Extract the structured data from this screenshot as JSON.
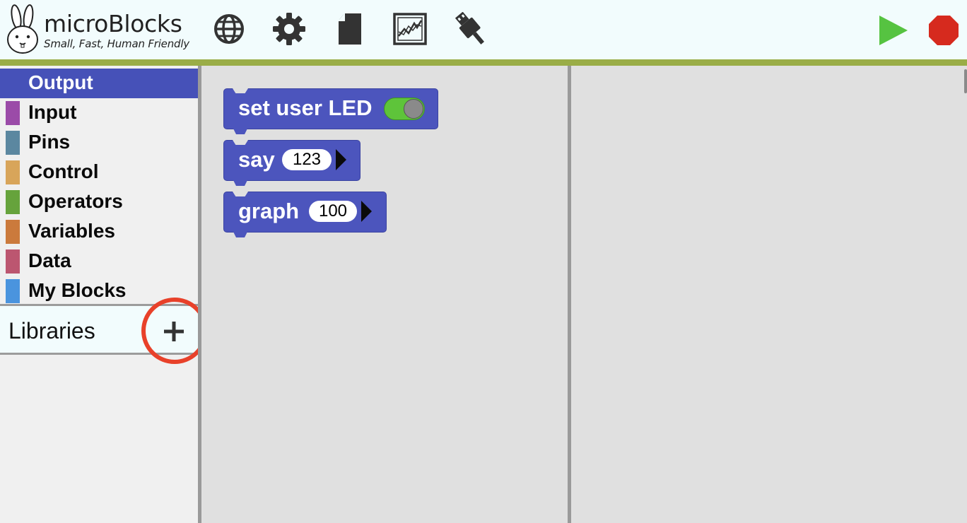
{
  "header": {
    "app_name": "microBlocks",
    "tagline": "Small, Fast, Human Friendly",
    "icons": [
      "bunny-logo-icon",
      "globe-icon",
      "gear-icon",
      "file-icon",
      "graph-icon",
      "usb-plug-icon",
      "play-icon",
      "stop-icon"
    ],
    "colors": {
      "go": "#56c341",
      "stop": "#d62a1e",
      "accent": "#9aad47"
    }
  },
  "palette": {
    "categories": [
      {
        "label": "Output",
        "color": "#4651b8",
        "selected": true
      },
      {
        "label": "Input",
        "color": "#9b4ba8"
      },
      {
        "label": "Pins",
        "color": "#5b87a0"
      },
      {
        "label": "Control",
        "color": "#d8a55a"
      },
      {
        "label": "Operators",
        "color": "#66a33c"
      },
      {
        "label": "Variables",
        "color": "#cb7a3c"
      },
      {
        "label": "Data",
        "color": "#bc5670"
      },
      {
        "label": "My Blocks",
        "color": "#4a94de"
      }
    ],
    "libraries_label": "Libraries",
    "add_library_icon": "plus-icon"
  },
  "blocks": {
    "set_user_led": {
      "label": "set user LED",
      "toggle_on": true
    },
    "say": {
      "label": "say",
      "value": "123"
    },
    "graph": {
      "label": "graph",
      "value": "100"
    }
  }
}
